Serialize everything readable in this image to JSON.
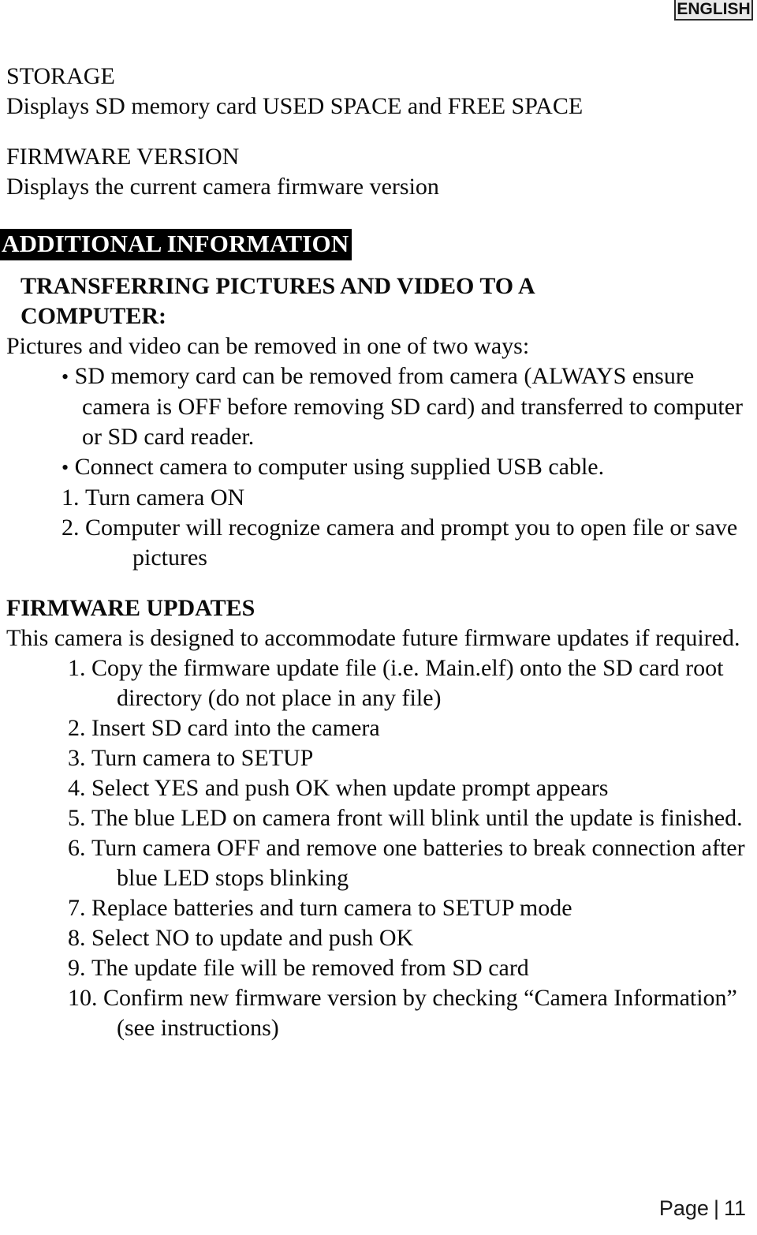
{
  "language_badge": {
    "label": "ENGLISH"
  },
  "sections": {
    "storage": {
      "heading": "STORAGE",
      "body": "Displays SD memory card USED SPACE and FREE SPACE"
    },
    "firmware_version": {
      "heading": "FIRMWARE VERSION",
      "body": "Displays the current camera firmware version"
    },
    "additional_information": {
      "bar_heading": "ADDITIONAL INFORMATION"
    },
    "transferring": {
      "heading_line_1": "TRANSFERRING PICTURES AND VIDEO TO A",
      "heading_line_2": "COMPUTER:",
      "intro": "Pictures and video can be removed in one of two ways:",
      "bullets": [
        "SD memory card can be removed from camera (ALWAYS ensure camera is OFF before removing SD card) and transferred to computer or SD card reader.",
        "Connect camera to computer using supplied USB cable."
      ],
      "steps": [
        {
          "number": "1.",
          "text": "Turn camera ON"
        },
        {
          "number": "2.",
          "text": "Computer will recognize camera and prompt you to open file or save pictures"
        }
      ]
    },
    "firmware_updates": {
      "heading": "FIRMWARE UPDATES",
      "intro": "This camera is designed to accommodate future firmware updates if required.",
      "steps": [
        {
          "number": "1.",
          "text": "Copy the firmware update file (i.e. Main.elf) onto the SD card root directory (do not place in any file)"
        },
        {
          "number": "2.",
          "text": "Insert SD card into the camera"
        },
        {
          "number": "3.",
          "text": "Turn camera to SETUP"
        },
        {
          "number": "4.",
          "text": "Select YES and push OK when update prompt appears"
        },
        {
          "number": "5.",
          "text": "The blue LED on camera front will blink until the update is finished."
        },
        {
          "number": "6.",
          "text": "Turn camera OFF and remove one batteries to break connection after blue LED stops blinking"
        },
        {
          "number": "7.",
          "text": "Replace batteries and turn camera to SETUP mode"
        },
        {
          "number": "8.",
          "text": "Select NO to update and push OK"
        },
        {
          "number": "9.",
          "text": "The update file will be removed from SD card"
        },
        {
          "number": "10.",
          "text": "Confirm new firmware version by checking “Camera Information” (see instructions)"
        }
      ]
    }
  },
  "footer": {
    "page_label": "Page",
    "separator": "|",
    "page_number": "11"
  },
  "colors": {
    "text": "#0b0b0b",
    "bar_background": "#000000",
    "bar_text": "#ffffff",
    "badge_background": "#e9e9e9",
    "badge_border": "#2a2a2a"
  }
}
